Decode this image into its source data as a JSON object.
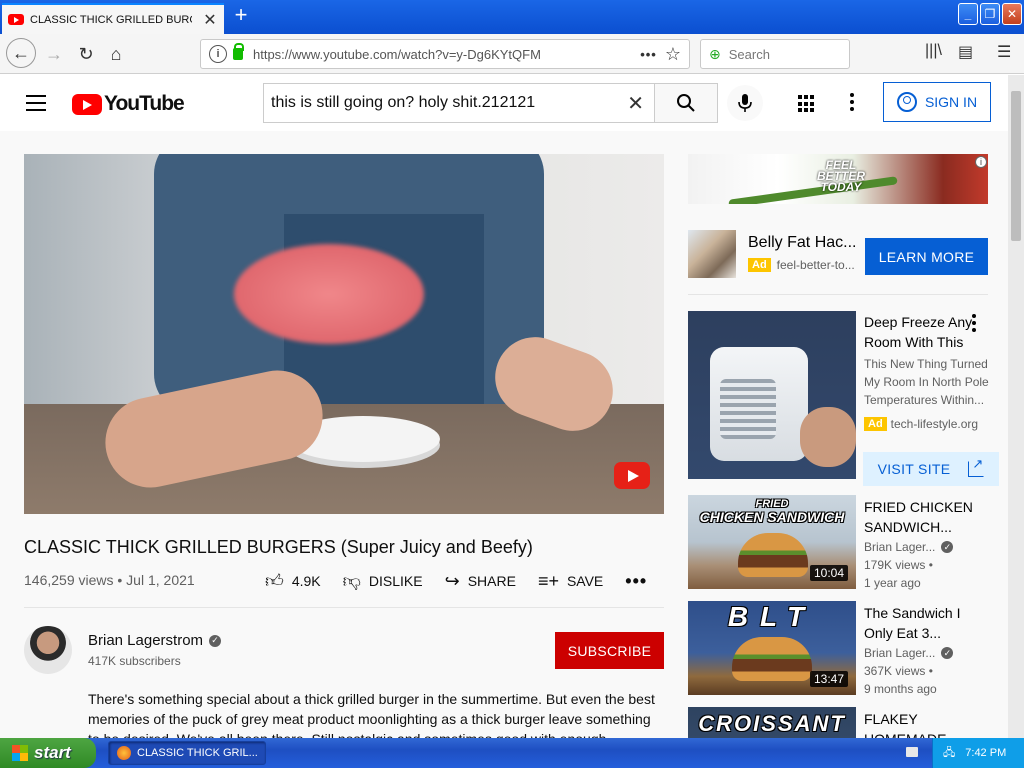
{
  "browser": {
    "tab_title": "CLASSIC THICK GRILLED BURGERS (Super Juicy and Beefy)",
    "url": "https://www.youtube.com/watch?v=y-Dg6KYtQFM",
    "search_placeholder": "Search"
  },
  "youtube": {
    "logo_text": "YouTube",
    "search_query": "this is still going on? holy shit.212121",
    "sign_in_label": "SIGN IN"
  },
  "video": {
    "title": "CLASSIC THICK GRILLED BURGERS (Super Juicy and Beefy)",
    "views_date": "146,259 views • Jul 1, 2021",
    "like_count": "4.9K",
    "dislike_label": "DISLIKE",
    "share_label": "SHARE",
    "save_label": "SAVE"
  },
  "channel": {
    "name": "Brian Lagerstrom",
    "subscribers": "417K subscribers",
    "subscribe_label": "SUBSCRIBE"
  },
  "description": "There's something special about a thick grilled burger in the summertime. But even the best memories of the puck of grey meat product moonlighting as a thick burger leave something to be desired. We've all been there. Still nostalgic and sometimes good with enough toppings",
  "ads": {
    "banner_text": "FEEL BETTER TODAY",
    "ad1": {
      "title": "Belly Fat Hac...",
      "badge": "Ad",
      "domain": "feel-better-to...",
      "cta": "LEARN MORE"
    },
    "ad2": {
      "title": "Deep Freeze Any Room With This",
      "body": "This New Thing Turned My Room In North Pole Temperatures Within...",
      "badge": "Ad",
      "domain": "tech-lifestyle.org",
      "cta": "VISIT SITE"
    }
  },
  "recommendations": [
    {
      "thumb_text": "FRIED CHICKEN SANDWICH",
      "thumb_small": "FRIED",
      "thumb_big": "CHICKEN SANDWICH",
      "duration": "10:04",
      "title": "FRIED CHICKEN SANDWICH...",
      "channel": "Brian Lager...",
      "views": "179K views •",
      "age": "1 year ago"
    },
    {
      "thumb_text": "BLT",
      "duration": "13:47",
      "title": "The Sandwich I Only Eat 3...",
      "channel": "Brian Lager...",
      "views": "367K views •",
      "age": "9 months ago"
    },
    {
      "thumb_text": "CROISSANT",
      "title": "FLAKEY HOMEMADE"
    }
  ],
  "taskbar": {
    "start_label": "start",
    "task_label": "CLASSIC THICK GRIL...",
    "clock": "7:42 PM"
  },
  "icons": [
    "youtube-favicon",
    "close-icon",
    "plus-icon",
    "back-icon",
    "forward-icon",
    "reload-icon",
    "home-icon",
    "info-icon",
    "lock-icon",
    "page-actions-icon",
    "bookmark-star-icon",
    "library-icon",
    "sidebar-icon",
    "menu-icon",
    "hamburger-icon",
    "search-icon",
    "clear-icon",
    "mic-icon",
    "apps-icon",
    "more-icon",
    "account-icon",
    "like-icon",
    "dislike-icon",
    "share-icon",
    "save-icon",
    "verified-icon",
    "external-link-icon"
  ]
}
